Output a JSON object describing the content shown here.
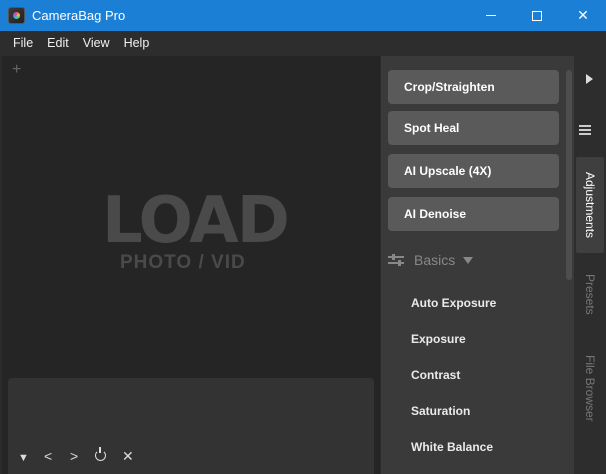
{
  "window": {
    "title": "CameraBag Pro",
    "controls": {
      "minimize": "",
      "maximize": "",
      "close": "✕"
    }
  },
  "menu": [
    "File",
    "Edit",
    "View",
    "Help"
  ],
  "canvas": {
    "add_symbol": "+",
    "load_title": "LOAD",
    "load_subtitle": "PHOTO / VID"
  },
  "playback": {
    "down": "▼",
    "prev": "<",
    "next": ">",
    "close": "✕"
  },
  "adjustments": {
    "buttons": [
      "Crop/Straighten",
      "Spot Heal",
      "AI Upscale (4X)",
      "AI Denoise"
    ],
    "section_label": "Basics",
    "items": [
      "Auto Exposure",
      "Exposure",
      "Contrast",
      "Saturation",
      "White Balance"
    ]
  },
  "tabs": {
    "adjustments": "Adjustments",
    "presets": "Presets",
    "file_browser": "File Browser"
  },
  "colors": {
    "titlebar": "#1c7fd6",
    "panel": "#3a3a3a",
    "button": "#5a5a5a"
  }
}
